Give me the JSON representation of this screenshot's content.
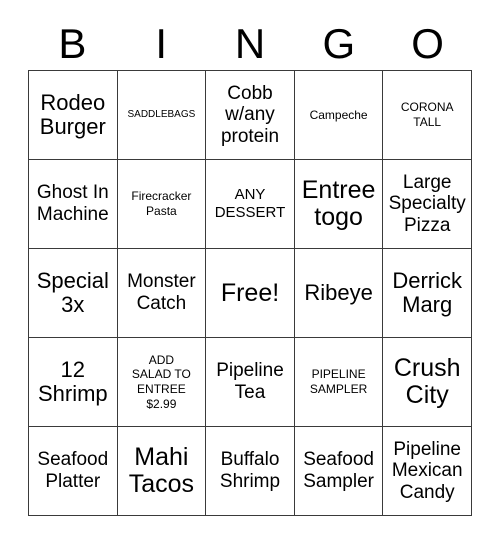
{
  "card": {
    "title": "BINGO Card",
    "header_letters": [
      "B",
      "I",
      "N",
      "G",
      "O"
    ],
    "colors": {
      "border": "#3a3a3a",
      "text": "#000000",
      "background": "#ffffff"
    },
    "free_space_label": "Free!",
    "free_space_position": {
      "row": 3,
      "column": 3
    },
    "cells": [
      {
        "text": "Rodeo\nBurger",
        "size": "fs-lg"
      },
      {
        "text": "SADDLEBAGS",
        "size": "fs-xxs"
      },
      {
        "text": "Cobb\nw/any\nprotein",
        "size": "fs-md"
      },
      {
        "text": "Campeche",
        "size": "fs-xs"
      },
      {
        "text": "CORONA\nTALL",
        "size": "fs-xs"
      },
      {
        "text": "Ghost In\nMachine",
        "size": "fs-md"
      },
      {
        "text": "Firecracker\nPasta",
        "size": "fs-xs"
      },
      {
        "text": "ANY\nDESSERT",
        "size": "fs-sm"
      },
      {
        "text": "Entree\ntogo",
        "size": "fs-xl"
      },
      {
        "text": "Large\nSpecialty\nPizza",
        "size": "fs-md"
      },
      {
        "text": "Special\n3x",
        "size": "fs-lg"
      },
      {
        "text": "Monster\nCatch",
        "size": "fs-md"
      },
      {
        "text": "Free!",
        "size": "fs-xl"
      },
      {
        "text": "Ribeye",
        "size": "fs-lg"
      },
      {
        "text": "Derrick\nMarg",
        "size": "fs-lg"
      },
      {
        "text": "12\nShrimp",
        "size": "fs-lg"
      },
      {
        "text": "ADD\nSALAD TO\nENTREE\n$2.99",
        "size": "fs-xs"
      },
      {
        "text": "Pipeline\nTea",
        "size": "fs-md"
      },
      {
        "text": "PIPELINE\nSAMPLER",
        "size": "fs-xs"
      },
      {
        "text": "Crush\nCity",
        "size": "fs-xl"
      },
      {
        "text": "Seafood\nPlatter",
        "size": "fs-md"
      },
      {
        "text": "Mahi\nTacos",
        "size": "fs-xl"
      },
      {
        "text": "Buffalo\nShrimp",
        "size": "fs-md"
      },
      {
        "text": "Seafood\nSampler",
        "size": "fs-md"
      },
      {
        "text": "Pipeline\nMexican\nCandy",
        "size": "fs-md"
      }
    ]
  }
}
